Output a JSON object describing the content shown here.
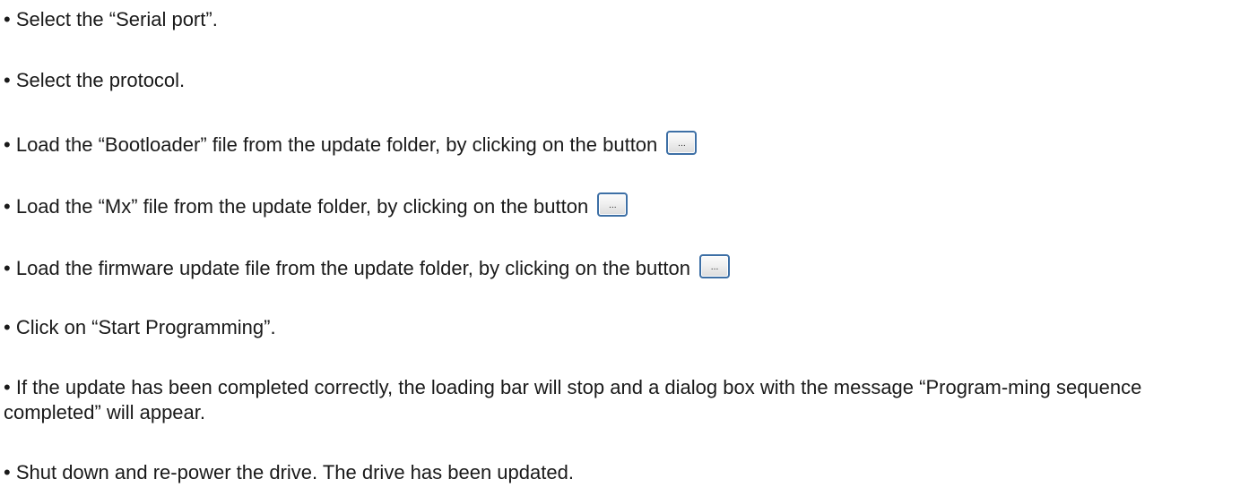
{
  "bullet": "•",
  "steps": [
    {
      "text": "Select the “Serial port”."
    },
    {
      "text": "Select the protocol."
    },
    {
      "text": "Load the “Bootloader” file from the update folder, by clicking on the button",
      "button_label": "..."
    },
    {
      "text": "Load the “Mx” file from the update folder, by clicking on the button",
      "button_label": "..."
    },
    {
      "text": "Load the firmware update file from the update folder, by clicking on the button",
      "button_label": "..."
    },
    {
      "text": "Click on “Start Programming”."
    },
    {
      "text": "If the update has been completed correctly, the loading bar will stop and a dialog box with the message “Program-ming sequence completed” will appear."
    },
    {
      "text": "Shut down and re-power the drive. The drive has been updated."
    }
  ]
}
